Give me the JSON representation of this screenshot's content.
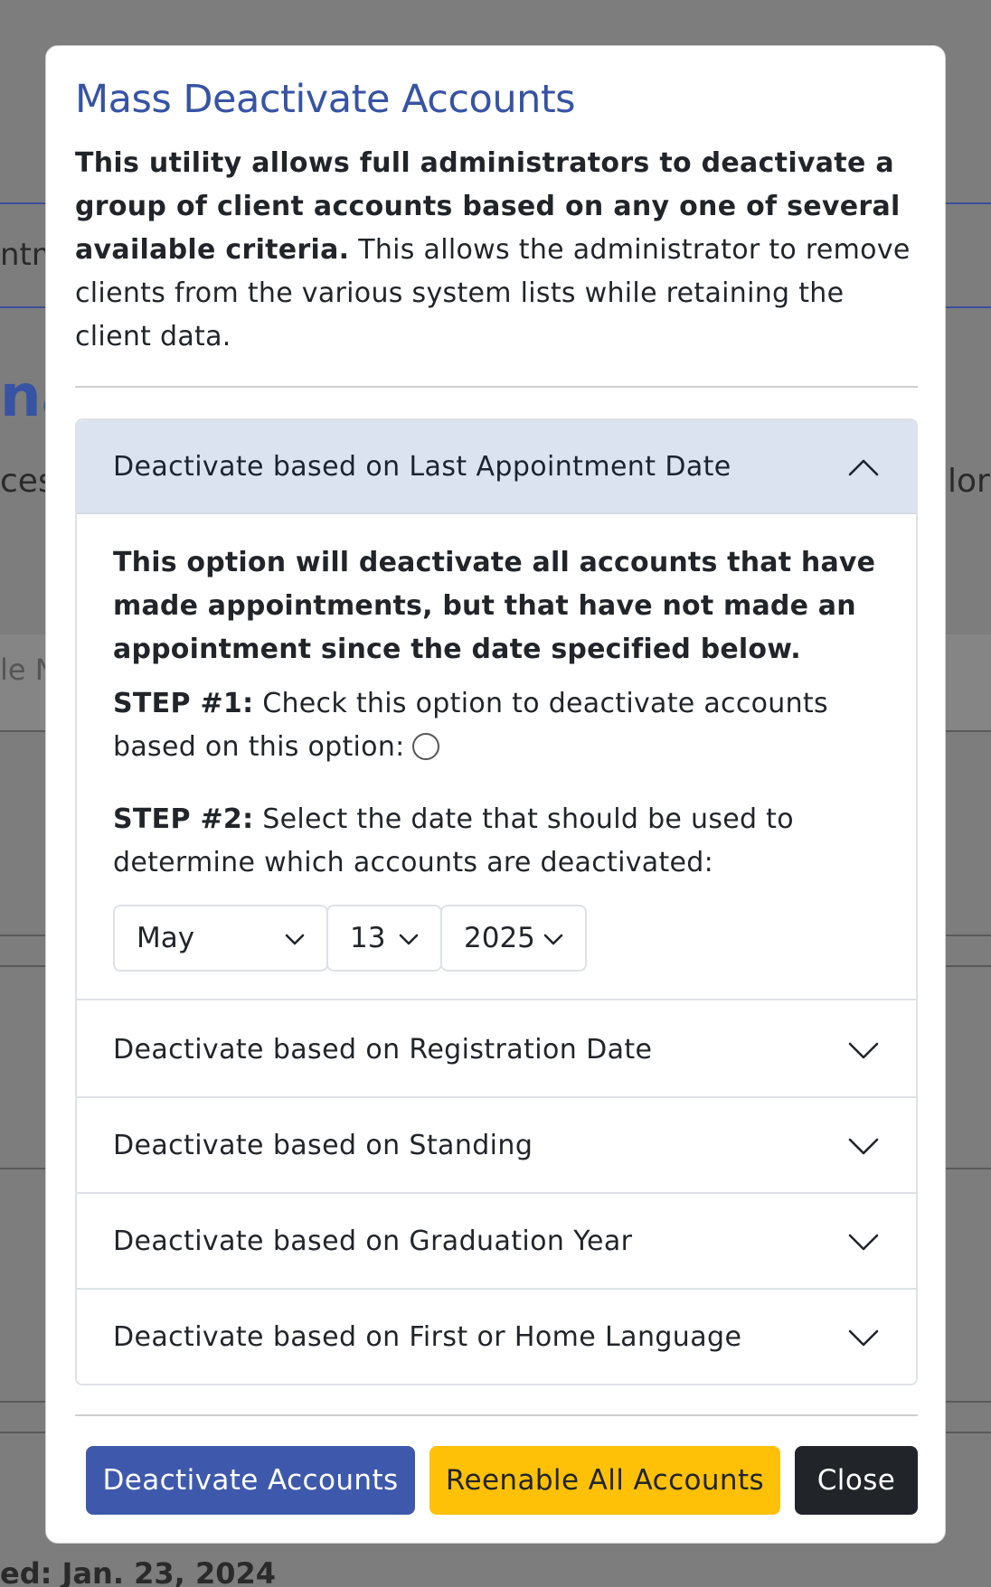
{
  "background": {
    "fragment_1": "ntm",
    "fragment_2": "na",
    "fragment_3": "ces",
    "fragment_4": "lore",
    "fragment_5": "le N",
    "footer_text": "ed: Jan. 23, 2024"
  },
  "modal": {
    "title": "Mass Deactivate Accounts",
    "intro_bold": "This utility allows full administrators to deactivate a group of client accounts based on any one of several available criteria.",
    "intro_rest": " This allows the administrator to remove clients from the various system lists while retaining the client data."
  },
  "accordion": {
    "active": {
      "label": "Deactivate based on Last Appointment Date",
      "description": "This option will deactivate all accounts that have made appointments, but that have not made an appointment since the date specified below.",
      "step1_label": "STEP #1:",
      "step1_text": " Check this option to deactivate accounts based on this option:",
      "step2_label": "STEP #2:",
      "step2_text": " Select the date that should be used to determine which accounts are deactivated:",
      "month": "May",
      "day": "13",
      "year": "2025"
    },
    "items": [
      {
        "label": "Deactivate based on Registration Date"
      },
      {
        "label": "Deactivate based on Standing"
      },
      {
        "label": "Deactivate based on Graduation Year"
      },
      {
        "label": "Deactivate based on First or Home Language"
      }
    ]
  },
  "footer": {
    "deactivate_label": "Deactivate Accounts",
    "reenable_label": "Reenable All Accounts",
    "close_label": "Close"
  },
  "colors": {
    "primary": "#3e59ac",
    "warning": "#ffc107",
    "dark": "#212529",
    "title": "#3753a4",
    "active_header": "#dbe3f1"
  }
}
